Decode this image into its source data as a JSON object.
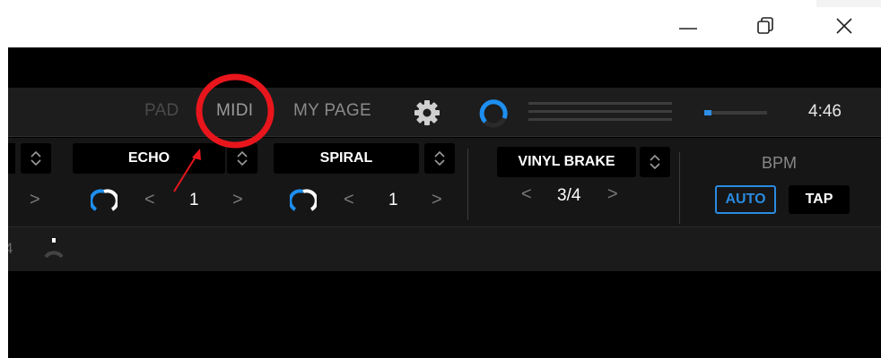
{
  "window": {
    "minimize_icon": "minimize-icon",
    "restore_icon": "restore-icon",
    "close_icon": "close-icon"
  },
  "toolbar": {
    "pad_label": "PAD",
    "midi_label": "MIDI",
    "mypage_label": "MY PAGE",
    "settings_icon": "gear-icon",
    "time": "4:46",
    "level_fraction": 0.12
  },
  "fx": {
    "slot1": {
      "name": "ECHO",
      "beat": "1"
    },
    "slot2": {
      "name": "SPIRAL",
      "beat": "1"
    },
    "beat_fx": {
      "name": "VINYL BRAKE",
      "beat": "3/4"
    }
  },
  "bpm": {
    "label": "BPM",
    "auto_label": "AUTO",
    "tap_label": "TAP"
  },
  "colors": {
    "accent_blue": "#2a8be0",
    "annotation_red": "#e8161c",
    "background": "#000000"
  }
}
